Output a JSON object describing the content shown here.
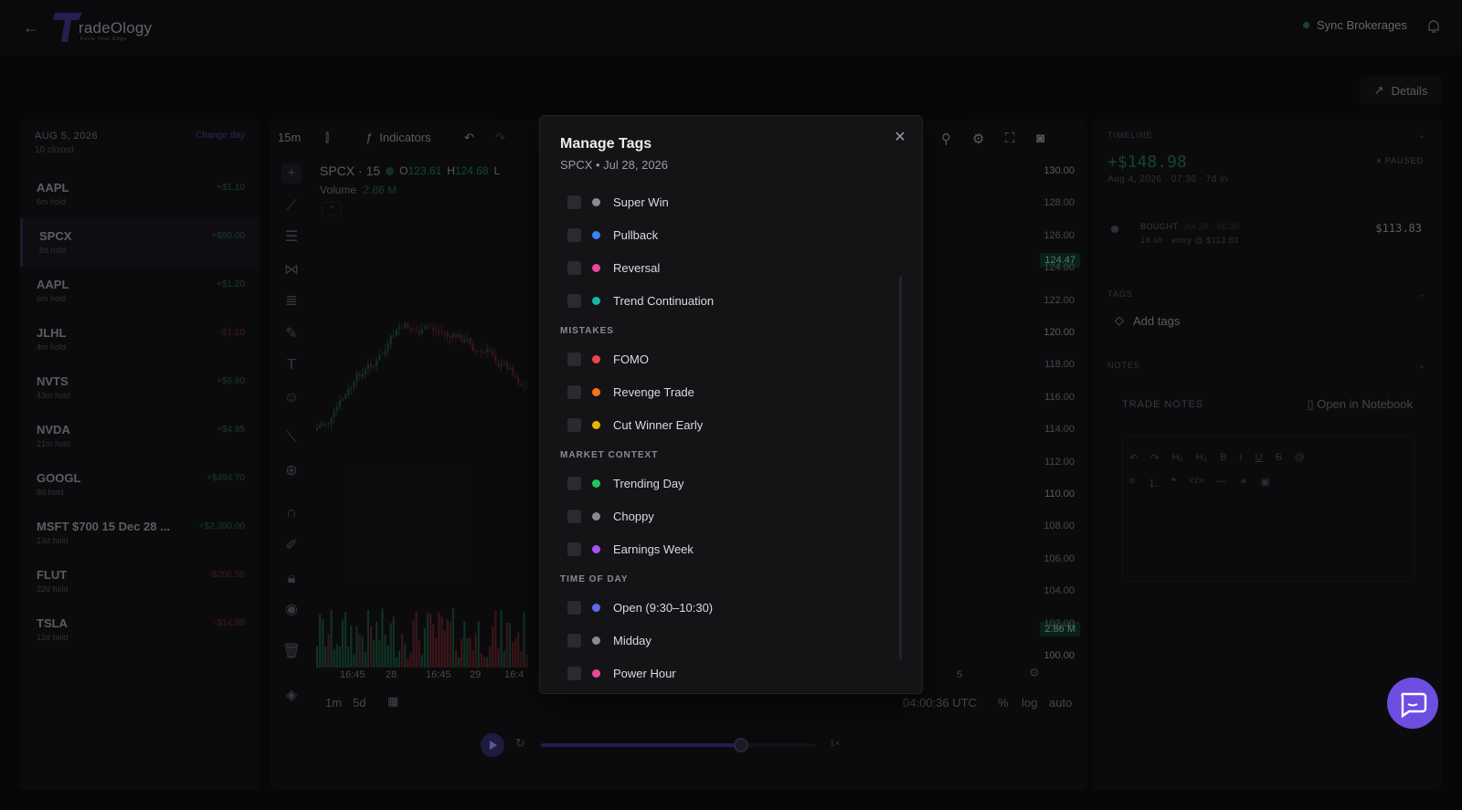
{
  "header": {
    "logo_text": "radeOlogy",
    "logo_tagline": "Know Your Edge",
    "sync_label": "Sync Brokerages",
    "details_label": "Details"
  },
  "left_panel": {
    "date": "AUG 5, 2026",
    "closed": "10 closed",
    "change_day": "Change day",
    "trades": [
      {
        "symbol": "AAPL",
        "hold": "6m hold",
        "pnl": "+$1.10",
        "sign": "pos"
      },
      {
        "symbol": "SPCX",
        "hold": "8d hold",
        "pnl": "+$99.00",
        "sign": "pos"
      },
      {
        "symbol": "AAPL",
        "hold": "6m hold",
        "pnl": "+$1.20",
        "sign": "pos"
      },
      {
        "symbol": "JLHL",
        "hold": "4m hold",
        "pnl": "-$1.10",
        "sign": "neg"
      },
      {
        "symbol": "NVTS",
        "hold": "43m hold",
        "pnl": "+$6.60",
        "sign": "pos"
      },
      {
        "symbol": "NVDA",
        "hold": "21m hold",
        "pnl": "+$4.95",
        "sign": "pos"
      },
      {
        "symbol": "GOOGL",
        "hold": "8d hold",
        "pnl": "+$494.70",
        "sign": "pos"
      },
      {
        "symbol": "MSFT $700 15 Dec 28 ...",
        "hold": "13d hold",
        "pnl": "+$2,350.00",
        "sign": "pos"
      },
      {
        "symbol": "FLUT",
        "hold": "22d hold",
        "pnl": "-$206.56",
        "sign": "neg"
      },
      {
        "symbol": "TSLA",
        "hold": "12d hold",
        "pnl": "-$14.88",
        "sign": "neg"
      }
    ]
  },
  "chart": {
    "interval": "15m",
    "indicators_label": "Indicators",
    "symbol_line": "SPCX · 15",
    "open_label": "O",
    "open_value": "123.61",
    "high_label": "H",
    "high_value": "124.68",
    "low_label": "L",
    "volume_label": "Volume",
    "volume_value": "2.86 M",
    "price_labels": [
      "130.00",
      "128.00",
      "126.00",
      "124.00",
      "122.00",
      "120.00",
      "118.00",
      "116.00",
      "114.00",
      "112.00",
      "110.00",
      "108.00",
      "106.00",
      "104.00",
      "102.00",
      "100.00"
    ],
    "current_price": "124.47",
    "volume_badge": "2.86 M",
    "time_labels": [
      "16:45",
      "28",
      "16:45",
      "29",
      "16:4",
      "5"
    ],
    "range_1m": "1m",
    "range_5d": "5d",
    "clock": "04:00:36 UTC",
    "pct_label": "%",
    "log_label": "log",
    "auto_label": "auto",
    "speed_label": "1×",
    "replay_progress": 0.73
  },
  "right_panel": {
    "timeline_label": "TIMELINE",
    "pnl": "+$148.98",
    "meta": "Aug 4, 2026 · 07:30 · 7d in",
    "status": "PAUSED",
    "entry_action": "BOUGHT",
    "entry_date": "Jul 28 · 00:30",
    "entry_detail": "14 sh · entry @ $113.83",
    "entry_price": "$113.83",
    "tags_label": "TAGS",
    "add_tags": "Add tags",
    "notes_label": "NOTES",
    "trade_notes": "TRADE NOTES",
    "open_notebook": "Open in Notebook"
  },
  "modal": {
    "title": "Manage Tags",
    "subtitle": "SPCX • Jul 28, 2026",
    "groups": [
      {
        "name": "",
        "tags": [
          {
            "label": "Super Win",
            "color": "#8a8a92"
          },
          {
            "label": "Pullback",
            "color": "#3b82f6"
          },
          {
            "label": "Reversal",
            "color": "#ec4899"
          },
          {
            "label": "Trend Continuation",
            "color": "#14b8a6"
          }
        ]
      },
      {
        "name": "MISTAKES",
        "tags": [
          {
            "label": "FOMO",
            "color": "#ef4444"
          },
          {
            "label": "Revenge Trade",
            "color": "#f97316"
          },
          {
            "label": "Cut Winner Early",
            "color": "#eab308"
          }
        ]
      },
      {
        "name": "MARKET CONTEXT",
        "tags": [
          {
            "label": "Trending Day",
            "color": "#22c55e"
          },
          {
            "label": "Choppy",
            "color": "#8a8a92"
          },
          {
            "label": "Earnings Week",
            "color": "#a855f7"
          }
        ]
      },
      {
        "name": "TIME OF DAY",
        "tags": [
          {
            "label": "Open (9:30–10:30)",
            "color": "#6366f1"
          },
          {
            "label": "Midday",
            "color": "#8a8a92"
          },
          {
            "label": "Power Hour",
            "color": "#ec4899"
          }
        ]
      }
    ]
  }
}
